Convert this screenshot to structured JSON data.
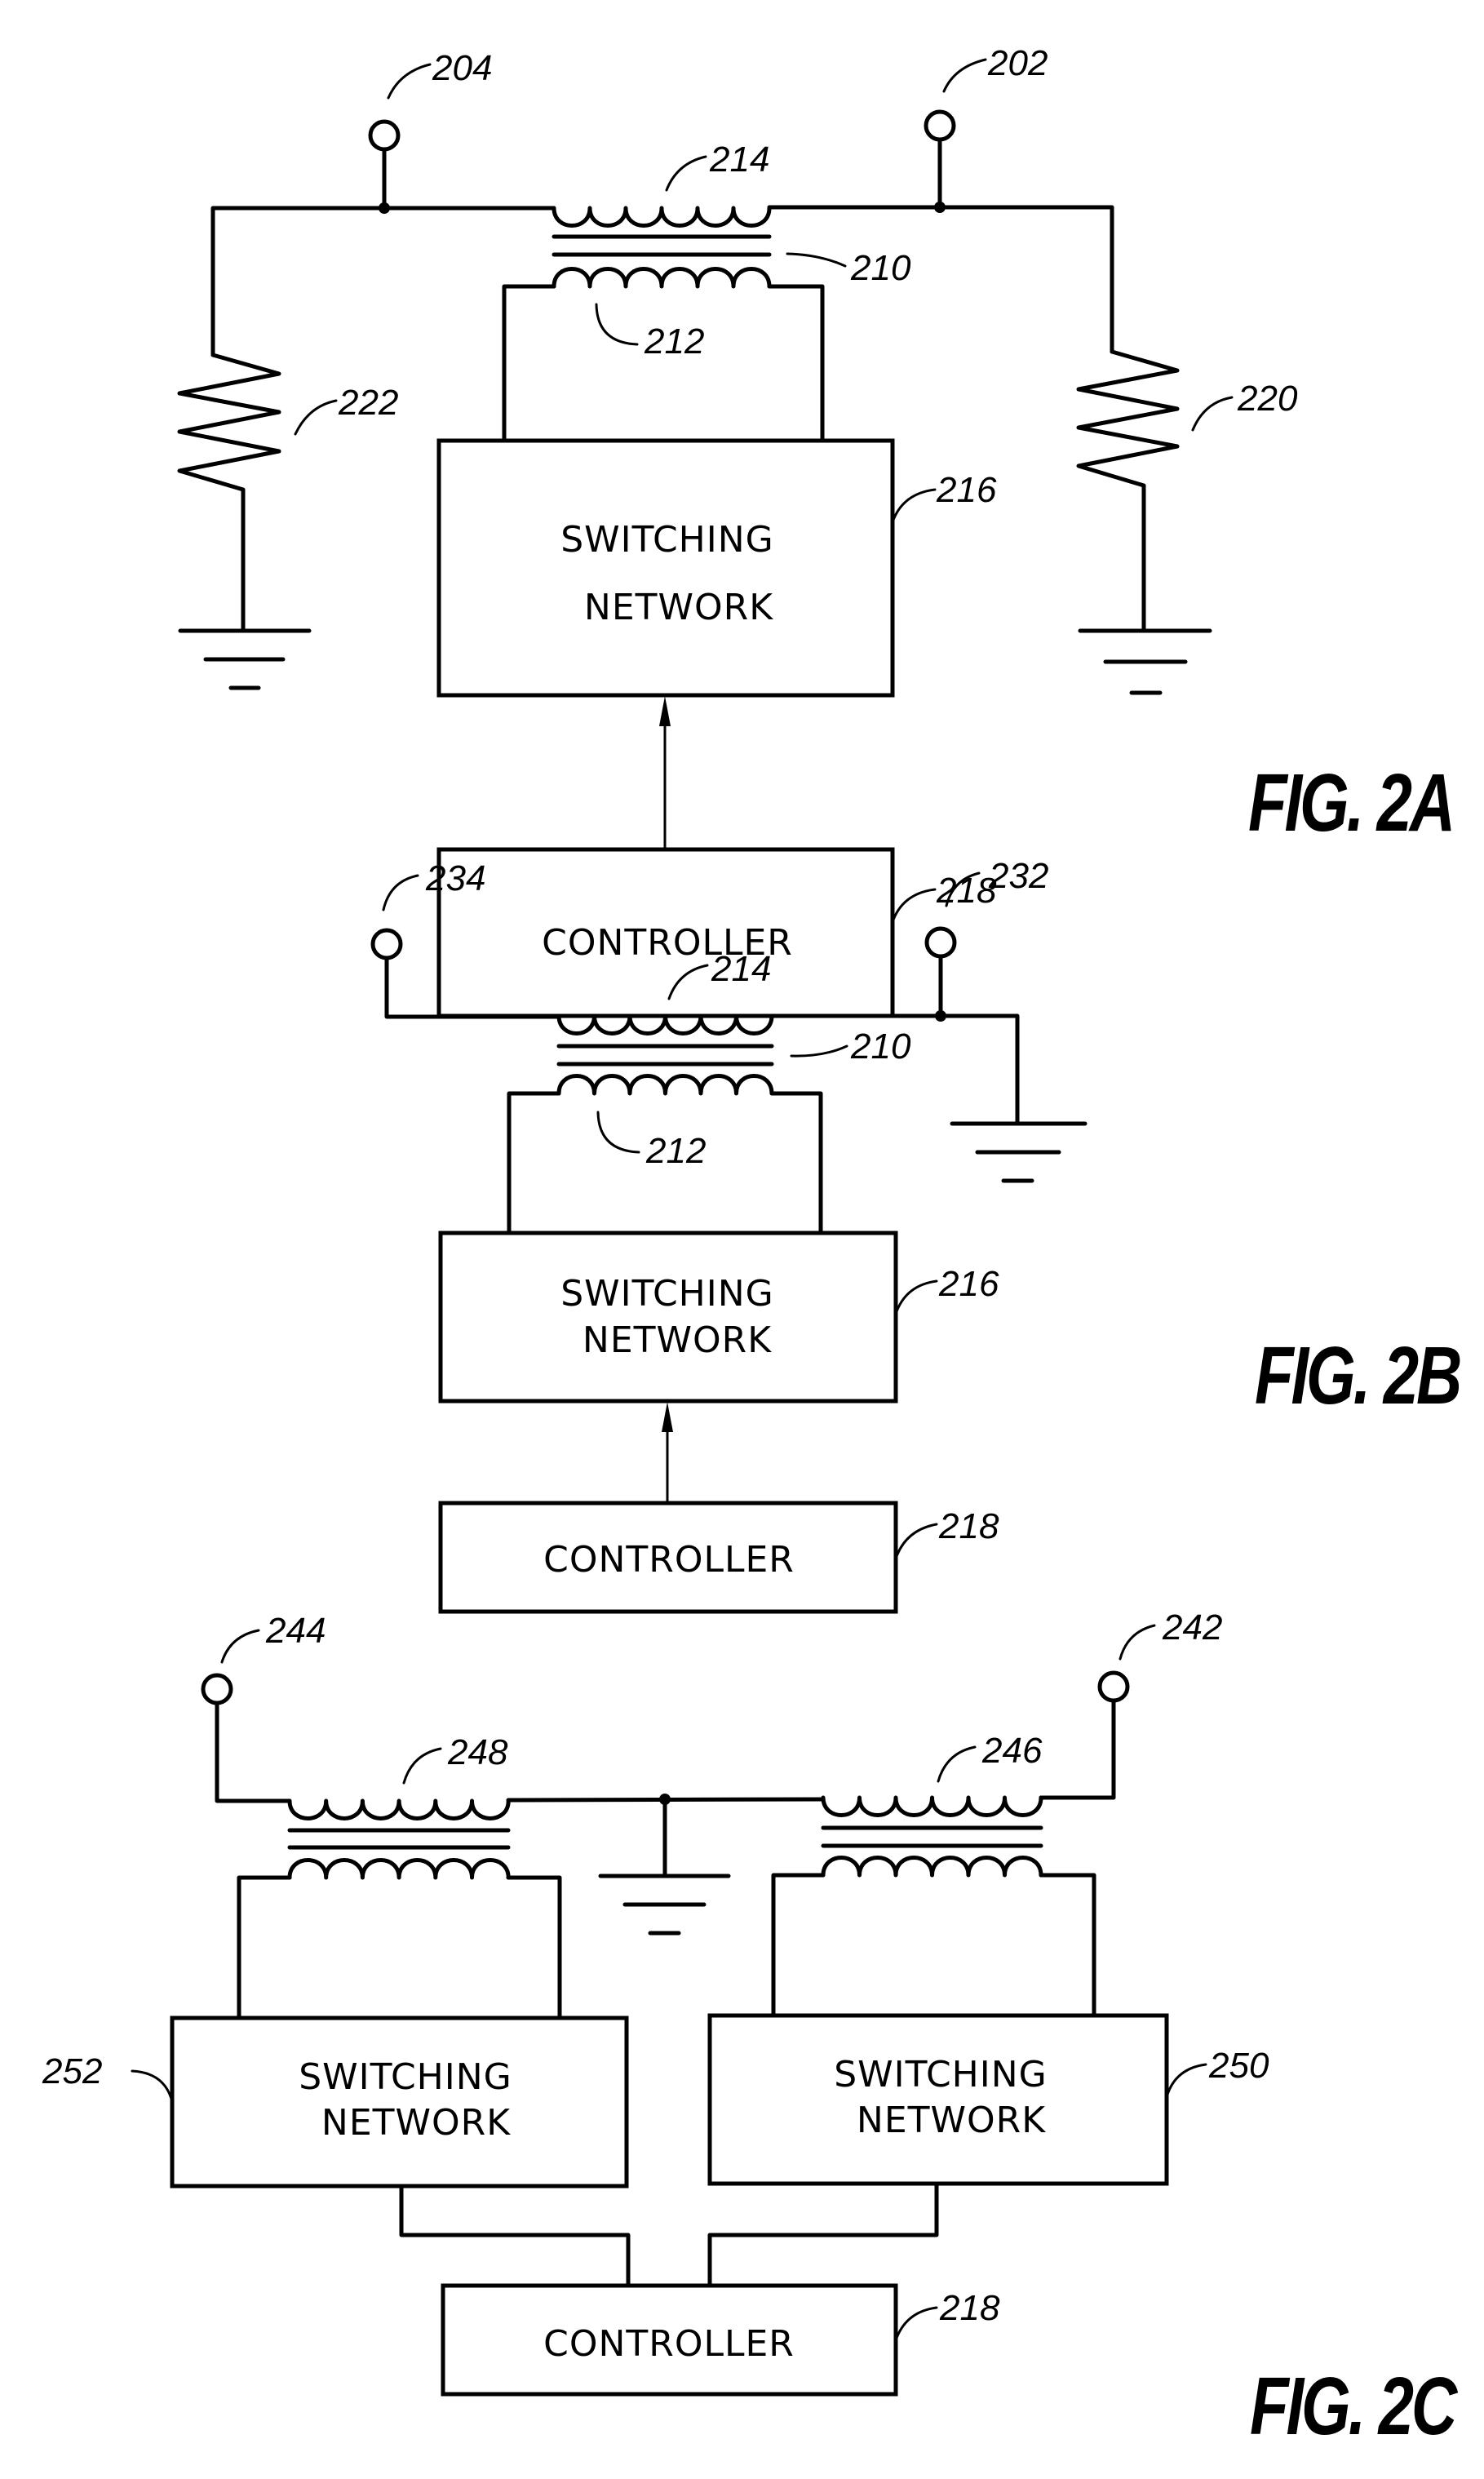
{
  "document": {
    "type": "patent-drawing-sheet",
    "figures": [
      {
        "id": "fig2a",
        "caption": "FIG. 2A",
        "terminals": [
          "204",
          "202"
        ],
        "refs": {
          "terminal_left": "204",
          "terminal_right": "202",
          "primary_winding": "214",
          "transformer": "210",
          "secondary_winding": "212",
          "resistor_left": "222",
          "resistor_right": "220",
          "switching_network": "216",
          "controller": "218"
        },
        "blocks": {
          "switching_line1": "SWITCHING",
          "switching_line2": "NETWORK",
          "controller": "CONTROLLER"
        }
      },
      {
        "id": "fig2b",
        "caption": "FIG. 2B",
        "refs": {
          "terminal_left": "234",
          "terminal_right": "232",
          "primary_winding": "214",
          "transformer": "210",
          "secondary_winding": "212",
          "switching_network": "216",
          "controller": "218"
        },
        "blocks": {
          "switching_line1": "SWITCHING",
          "switching_line2": "NETWORK",
          "controller": "CONTROLLER"
        }
      },
      {
        "id": "fig2c",
        "caption": "FIG. 2C",
        "refs": {
          "terminal_left": "244",
          "terminal_right": "242",
          "winding_left": "248",
          "winding_right": "246",
          "switching_network_left": "252",
          "switching_network_right": "250",
          "controller": "218"
        },
        "blocks": {
          "switching_line1": "SWITCHING",
          "switching_line2": "NETWORK",
          "controller": "CONTROLLER"
        }
      }
    ]
  }
}
